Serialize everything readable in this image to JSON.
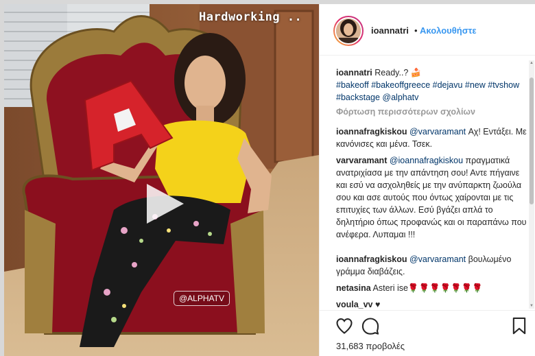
{
  "video": {
    "overlay_caption": "Hardworking ..",
    "watermark": "@ALPHATV"
  },
  "post": {
    "username": "ioannatri",
    "follow_label": "Ακολουθήστε",
    "caption_text": "Ready..? 🍰",
    "caption_hashtags": "#bakeoff #bakeoffgreece #dejavu #new #tvshow #backstage @alphatv",
    "load_more": "Φόρτωση περισσότερων σχολίων"
  },
  "comments": [
    {
      "user": "ioannafragkiskou",
      "mention": "@varvaramant",
      "text": "Αχ! Εντάξει. Με κανόνισες και μένα. Τσεκ."
    },
    {
      "user": "varvaramant",
      "mention": "@ioannafragkiskou",
      "text": "πραγματικά ανατριχίασα με την απάντηση σου! Αντε πήγαινε και εσύ να ασχοληθείς με την ανύπαρκτη ζωούλα σου και ασε αυτούς που όντως χαίρονται με τις επιτυχίες των άλλων. Εσύ βγάζει απλά το δηλητήριο όπως προφανώς και οι παραπάνω που ανέφερα. Λυπαμαι !!!"
    },
    {
      "user": "ioannafragkiskou",
      "mention": "@varvaramant",
      "text": "βουλωμένο γράμμα διαβάζεις."
    },
    {
      "user": "netasina",
      "mention": "",
      "text": "Asteri ise🌹🌹🌹🌹🌹🌹🌹"
    },
    {
      "user": "voula_vv",
      "mention": "",
      "text": "♥"
    }
  ],
  "actions": {
    "icons": [
      "heart-icon",
      "comment-icon",
      "bookmark-icon"
    ],
    "views": "31,683 προβολές"
  },
  "colors": {
    "link": "#003569",
    "follow": "#3897f0",
    "muted": "#999999"
  }
}
